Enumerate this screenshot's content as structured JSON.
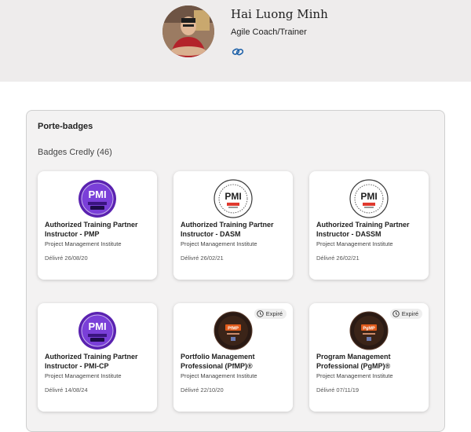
{
  "profile": {
    "name": "Hai Luong Minh",
    "role": "Agile Coach/Trainer"
  },
  "icons": {
    "link": "link-icon",
    "clock": "clock-icon"
  },
  "colors": {
    "header_band": "#eeecec",
    "panel_bg": "#f3f2f2",
    "pmi_purple": "#6b2fc4",
    "pmi_dark": "#2a1a14",
    "pmi_orange": "#e05a1a"
  },
  "badges_section": {
    "title": "Porte-badges",
    "subtitle": "Badges Credly (46)"
  },
  "badges": [
    {
      "title_line1": "Authorized Training Partner",
      "title_line2": "Instructor - PMP",
      "issuer": "Project Management Institute",
      "date": "Délivré 26/08/20",
      "style": "purple"
    },
    {
      "title_line1": "Authorized Training Partner",
      "title_line2": "Instructor - DASM",
      "issuer": "Project Management Institute",
      "date": "Délivré 26/02/21",
      "style": "white"
    },
    {
      "title_line1": "Authorized Training Partner",
      "title_line2": "Instructor - DASSM",
      "issuer": "Project Management Institute",
      "date": "Délivré 26/02/21",
      "style": "white"
    },
    {
      "title_line1": "Authorized Training Partner",
      "title_line2": "Instructor - PMI-CP",
      "issuer": "Project Management Institute",
      "date": "Délivré 14/08/24",
      "style": "purple"
    },
    {
      "title_line1": "Portfolio Management",
      "title_line2": "Professional (PfMP)®",
      "issuer": "Project Management Institute",
      "date": "Délivré 22/10/20",
      "style": "dark",
      "expired_label": "Expiré"
    },
    {
      "title_line1": "Program Management",
      "title_line2": "Professional (PgMP)®",
      "issuer": "Project Management Institute",
      "date": "Délivré 07/11/19",
      "style": "dark",
      "expired_label": "Expiré"
    }
  ]
}
